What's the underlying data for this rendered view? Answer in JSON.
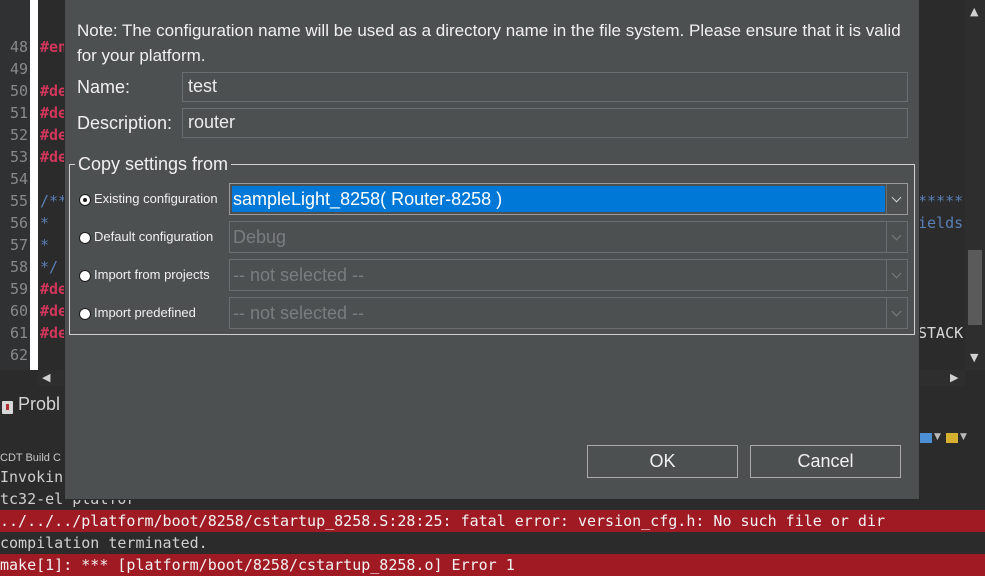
{
  "editor": {
    "line_numbers": [
      "48",
      "49",
      "50",
      "51",
      "52",
      "53",
      "54",
      "55",
      "56",
      "57",
      "58",
      "59",
      "60",
      "61",
      "62"
    ],
    "left_code": [
      {
        "text": "#en",
        "cls": "c-dir"
      },
      {
        "text": "",
        "cls": ""
      },
      {
        "text": "#de",
        "cls": "c-dir"
      },
      {
        "text": "#de",
        "cls": "c-dir"
      },
      {
        "text": "#de",
        "cls": "c-dir"
      },
      {
        "text": "#de",
        "cls": "c-dir"
      },
      {
        "text": "",
        "cls": ""
      },
      {
        "text": "/**",
        "cls": "c-cmt"
      },
      {
        "text": " *",
        "cls": "c-cmt"
      },
      {
        "text": " *",
        "cls": "c-cmt"
      },
      {
        "text": " */",
        "cls": "c-cmt"
      },
      {
        "text": "#de",
        "cls": "c-dir"
      },
      {
        "text": "#de",
        "cls": "c-dir"
      },
      {
        "text": "#de",
        "cls": "c-dir"
      },
      {
        "text": "",
        "cls": ""
      }
    ],
    "right_code": [
      {
        "line_index": 7,
        "text": "*****",
        "color": "#5a7fb6"
      },
      {
        "line_index": 8,
        "text": "ields",
        "color": "#5a7fb6"
      },
      {
        "line_index": 13,
        "text": "STACK",
        "color": "#d8d8d8"
      }
    ]
  },
  "bottom": {
    "problems_tab": "Probl",
    "console_title": "CDT Build C",
    "console_lines": [
      {
        "text": "Invokin",
        "error": false
      },
      {
        "text": "tc32-el                                                                     platfor",
        "error": false
      },
      {
        "text": "../../../platform/boot/8258/cstartup_8258.S:28:25: fatal error: version_cfg.h: No such file or dir",
        "error": true
      },
      {
        "text": "compilation terminated.",
        "error": false
      },
      {
        "text": "make[1]: *** [platform/boot/8258/cstartup_8258.o] Error 1",
        "error": true
      }
    ]
  },
  "dialog": {
    "note": "Note: The configuration name will be used as a directory name in the file system.  Please ensure that it is valid for your platform.",
    "name_label": "Name:",
    "name_value": "test",
    "description_label": "Description:",
    "description_value": "router",
    "group_title": "Copy settings from",
    "options": [
      {
        "label": "Existing configuration",
        "selected": true,
        "value": "sampleLight_8258( Router-8258 )",
        "enabled": true
      },
      {
        "label": "Default configuration",
        "selected": false,
        "value": "Debug",
        "enabled": false
      },
      {
        "label": "Import from projects",
        "selected": false,
        "value": "-- not selected --",
        "enabled": false
      },
      {
        "label": "Import predefined",
        "selected": false,
        "value": "-- not selected --",
        "enabled": false
      }
    ],
    "ok_label": "OK",
    "cancel_label": "Cancel"
  }
}
